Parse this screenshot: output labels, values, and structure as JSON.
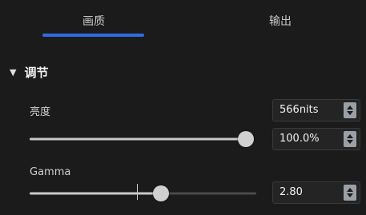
{
  "tabs": [
    {
      "label": "画质",
      "active": true
    },
    {
      "label": "输出",
      "active": false
    }
  ],
  "section": {
    "title": "调节",
    "expanded": true,
    "arrow_icon": "triangle-down-icon"
  },
  "brightness": {
    "label": "亮度",
    "nits_value": "566nits",
    "percent_value": "100.0%",
    "slider_fraction": 1.0
  },
  "gamma": {
    "label": "Gamma",
    "value": "2.80",
    "slider_fraction": 0.58
  },
  "colors": {
    "accent": "#2f6ce3",
    "background": "#1b1b1b"
  }
}
